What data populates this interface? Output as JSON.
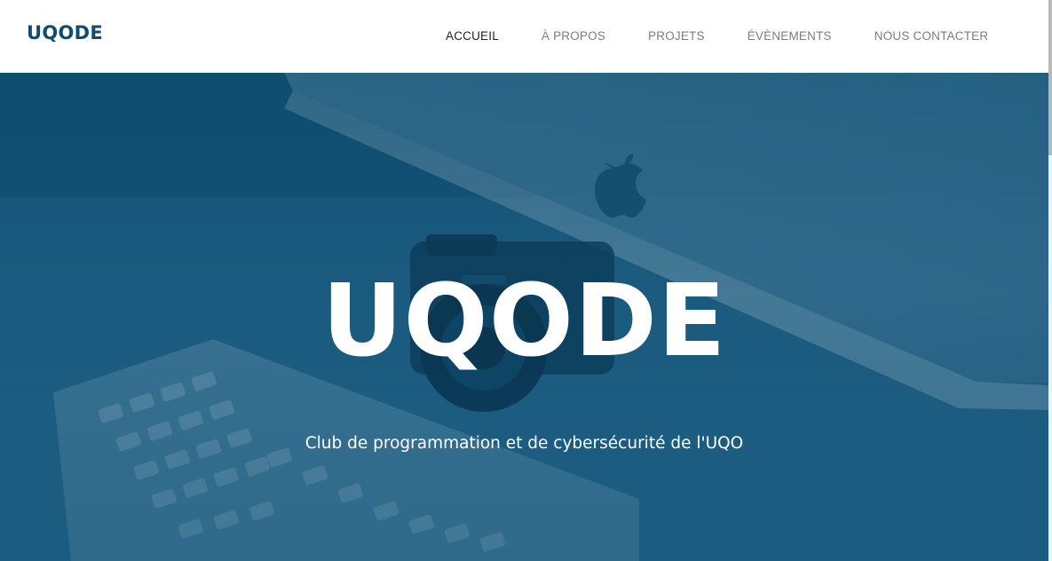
{
  "navbar": {
    "brand": "UQODE",
    "items": [
      {
        "label": "ACCUEIL",
        "active": true
      },
      {
        "label": "À PROPOS",
        "active": false
      },
      {
        "label": "PROJETS",
        "active": false
      },
      {
        "label": "ÉVÈNEMENTS",
        "active": false
      },
      {
        "label": "NOUS CONTACTER",
        "active": false
      }
    ]
  },
  "hero": {
    "title": "UQODE",
    "subtitle": "Club de programmation et de cybersécurité de l'UQO",
    "background_image_icons": [
      "computer-monitor-icon",
      "apple-logo-icon",
      "camera-icon",
      "keyboard-icon"
    ]
  },
  "colors": {
    "brand": "#0f4c6e",
    "nav_text": "#7d7d7d",
    "nav_active": "#222222",
    "hero_overlay": "#0a4a6e",
    "hero_text": "#ffffff"
  }
}
